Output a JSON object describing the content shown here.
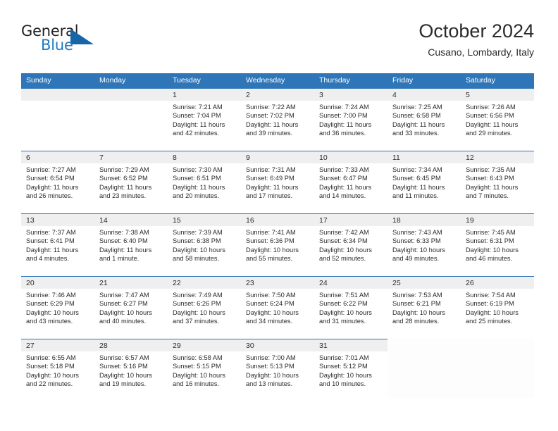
{
  "brand": {
    "name_top": "General",
    "name_bottom": "Blue",
    "accent_color": "#1565a8",
    "text_color": "#231f20"
  },
  "header": {
    "title": "October 2024",
    "subtitle": "Cusano, Lombardy, Italy"
  },
  "calendar": {
    "header_bg": "#2f76b8",
    "daynum_bg": "#efefef",
    "weekdays": [
      "Sunday",
      "Monday",
      "Tuesday",
      "Wednesday",
      "Thursday",
      "Friday",
      "Saturday"
    ],
    "weeks": [
      [
        {
          "day": "",
          "empty": true
        },
        {
          "day": "",
          "empty": true
        },
        {
          "day": "1",
          "sunrise": "Sunrise: 7:21 AM",
          "sunset": "Sunset: 7:04 PM",
          "daylight_1": "Daylight: 11 hours",
          "daylight_2": "and 42 minutes."
        },
        {
          "day": "2",
          "sunrise": "Sunrise: 7:22 AM",
          "sunset": "Sunset: 7:02 PM",
          "daylight_1": "Daylight: 11 hours",
          "daylight_2": "and 39 minutes."
        },
        {
          "day": "3",
          "sunrise": "Sunrise: 7:24 AM",
          "sunset": "Sunset: 7:00 PM",
          "daylight_1": "Daylight: 11 hours",
          "daylight_2": "and 36 minutes."
        },
        {
          "day": "4",
          "sunrise": "Sunrise: 7:25 AM",
          "sunset": "Sunset: 6:58 PM",
          "daylight_1": "Daylight: 11 hours",
          "daylight_2": "and 33 minutes."
        },
        {
          "day": "5",
          "sunrise": "Sunrise: 7:26 AM",
          "sunset": "Sunset: 6:56 PM",
          "daylight_1": "Daylight: 11 hours",
          "daylight_2": "and 29 minutes."
        }
      ],
      [
        {
          "day": "6",
          "sunrise": "Sunrise: 7:27 AM",
          "sunset": "Sunset: 6:54 PM",
          "daylight_1": "Daylight: 11 hours",
          "daylight_2": "and 26 minutes."
        },
        {
          "day": "7",
          "sunrise": "Sunrise: 7:29 AM",
          "sunset": "Sunset: 6:52 PM",
          "daylight_1": "Daylight: 11 hours",
          "daylight_2": "and 23 minutes."
        },
        {
          "day": "8",
          "sunrise": "Sunrise: 7:30 AM",
          "sunset": "Sunset: 6:51 PM",
          "daylight_1": "Daylight: 11 hours",
          "daylight_2": "and 20 minutes."
        },
        {
          "day": "9",
          "sunrise": "Sunrise: 7:31 AM",
          "sunset": "Sunset: 6:49 PM",
          "daylight_1": "Daylight: 11 hours",
          "daylight_2": "and 17 minutes."
        },
        {
          "day": "10",
          "sunrise": "Sunrise: 7:33 AM",
          "sunset": "Sunset: 6:47 PM",
          "daylight_1": "Daylight: 11 hours",
          "daylight_2": "and 14 minutes."
        },
        {
          "day": "11",
          "sunrise": "Sunrise: 7:34 AM",
          "sunset": "Sunset: 6:45 PM",
          "daylight_1": "Daylight: 11 hours",
          "daylight_2": "and 11 minutes."
        },
        {
          "day": "12",
          "sunrise": "Sunrise: 7:35 AM",
          "sunset": "Sunset: 6:43 PM",
          "daylight_1": "Daylight: 11 hours",
          "daylight_2": "and 7 minutes."
        }
      ],
      [
        {
          "day": "13",
          "sunrise": "Sunrise: 7:37 AM",
          "sunset": "Sunset: 6:41 PM",
          "daylight_1": "Daylight: 11 hours",
          "daylight_2": "and 4 minutes."
        },
        {
          "day": "14",
          "sunrise": "Sunrise: 7:38 AM",
          "sunset": "Sunset: 6:40 PM",
          "daylight_1": "Daylight: 11 hours",
          "daylight_2": "and 1 minute."
        },
        {
          "day": "15",
          "sunrise": "Sunrise: 7:39 AM",
          "sunset": "Sunset: 6:38 PM",
          "daylight_1": "Daylight: 10 hours",
          "daylight_2": "and 58 minutes."
        },
        {
          "day": "16",
          "sunrise": "Sunrise: 7:41 AM",
          "sunset": "Sunset: 6:36 PM",
          "daylight_1": "Daylight: 10 hours",
          "daylight_2": "and 55 minutes."
        },
        {
          "day": "17",
          "sunrise": "Sunrise: 7:42 AM",
          "sunset": "Sunset: 6:34 PM",
          "daylight_1": "Daylight: 10 hours",
          "daylight_2": "and 52 minutes."
        },
        {
          "day": "18",
          "sunrise": "Sunrise: 7:43 AM",
          "sunset": "Sunset: 6:33 PM",
          "daylight_1": "Daylight: 10 hours",
          "daylight_2": "and 49 minutes."
        },
        {
          "day": "19",
          "sunrise": "Sunrise: 7:45 AM",
          "sunset": "Sunset: 6:31 PM",
          "daylight_1": "Daylight: 10 hours",
          "daylight_2": "and 46 minutes."
        }
      ],
      [
        {
          "day": "20",
          "sunrise": "Sunrise: 7:46 AM",
          "sunset": "Sunset: 6:29 PM",
          "daylight_1": "Daylight: 10 hours",
          "daylight_2": "and 43 minutes."
        },
        {
          "day": "21",
          "sunrise": "Sunrise: 7:47 AM",
          "sunset": "Sunset: 6:27 PM",
          "daylight_1": "Daylight: 10 hours",
          "daylight_2": "and 40 minutes."
        },
        {
          "day": "22",
          "sunrise": "Sunrise: 7:49 AM",
          "sunset": "Sunset: 6:26 PM",
          "daylight_1": "Daylight: 10 hours",
          "daylight_2": "and 37 minutes."
        },
        {
          "day": "23",
          "sunrise": "Sunrise: 7:50 AM",
          "sunset": "Sunset: 6:24 PM",
          "daylight_1": "Daylight: 10 hours",
          "daylight_2": "and 34 minutes."
        },
        {
          "day": "24",
          "sunrise": "Sunrise: 7:51 AM",
          "sunset": "Sunset: 6:22 PM",
          "daylight_1": "Daylight: 10 hours",
          "daylight_2": "and 31 minutes."
        },
        {
          "day": "25",
          "sunrise": "Sunrise: 7:53 AM",
          "sunset": "Sunset: 6:21 PM",
          "daylight_1": "Daylight: 10 hours",
          "daylight_2": "and 28 minutes."
        },
        {
          "day": "26",
          "sunrise": "Sunrise: 7:54 AM",
          "sunset": "Sunset: 6:19 PM",
          "daylight_1": "Daylight: 10 hours",
          "daylight_2": "and 25 minutes."
        }
      ],
      [
        {
          "day": "27",
          "sunrise": "Sunrise: 6:55 AM",
          "sunset": "Sunset: 5:18 PM",
          "daylight_1": "Daylight: 10 hours",
          "daylight_2": "and 22 minutes."
        },
        {
          "day": "28",
          "sunrise": "Sunrise: 6:57 AM",
          "sunset": "Sunset: 5:16 PM",
          "daylight_1": "Daylight: 10 hours",
          "daylight_2": "and 19 minutes."
        },
        {
          "day": "29",
          "sunrise": "Sunrise: 6:58 AM",
          "sunset": "Sunset: 5:15 PM",
          "daylight_1": "Daylight: 10 hours",
          "daylight_2": "and 16 minutes."
        },
        {
          "day": "30",
          "sunrise": "Sunrise: 7:00 AM",
          "sunset": "Sunset: 5:13 PM",
          "daylight_1": "Daylight: 10 hours",
          "daylight_2": "and 13 minutes."
        },
        {
          "day": "31",
          "sunrise": "Sunrise: 7:01 AM",
          "sunset": "Sunset: 5:12 PM",
          "daylight_1": "Daylight: 10 hours",
          "daylight_2": "and 10 minutes."
        },
        {
          "day": "",
          "empty": true,
          "trailing": true
        },
        {
          "day": "",
          "empty": true,
          "trailing": true
        }
      ]
    ]
  }
}
